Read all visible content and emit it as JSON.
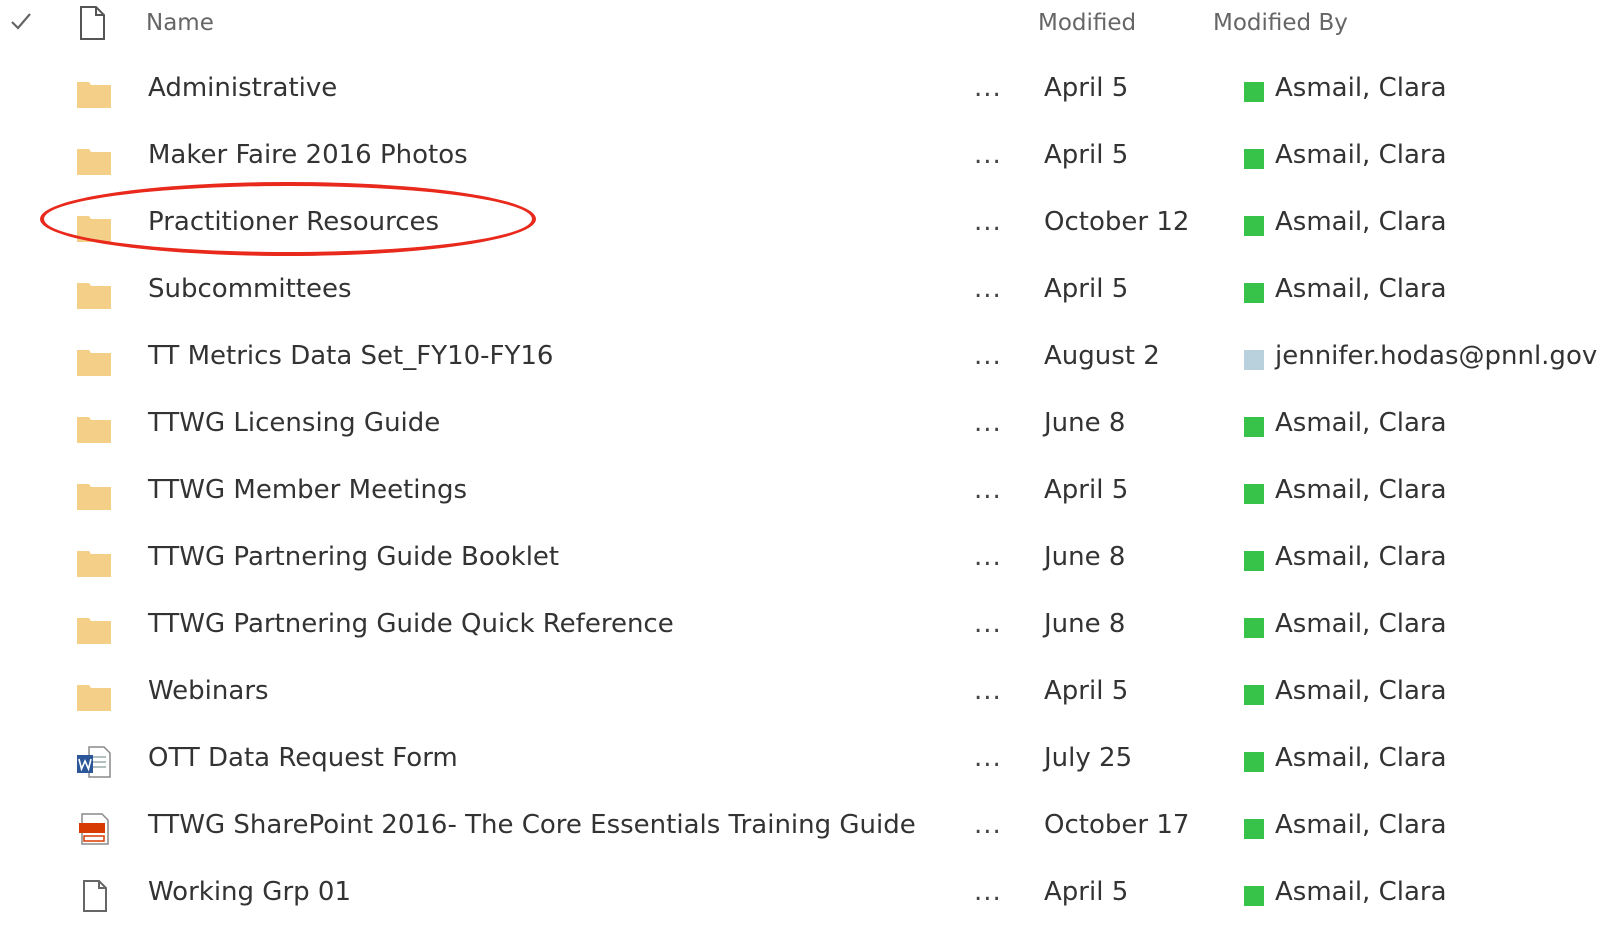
{
  "header": {
    "name_label": "Name",
    "modified_label": "Modified",
    "modified_by_label": "Modified By"
  },
  "colors": {
    "folder": "#f3cf87",
    "presence_available": "#37c24a",
    "presence_unknown": "#b9d1dd",
    "annotation": "#e8291c",
    "word_blue": "#2b579a",
    "pdf_red": "#d83b01"
  },
  "more_glyph": "...",
  "rows": [
    {
      "icon": "folder-icon",
      "name": "Administrative",
      "modified": "April 5",
      "modified_by": "Asmail, Clara",
      "presence": "presence_available"
    },
    {
      "icon": "folder-icon",
      "name": "Maker Faire 2016 Photos",
      "modified": "April 5",
      "modified_by": "Asmail, Clara",
      "presence": "presence_available"
    },
    {
      "icon": "folder-icon",
      "name": "Practitioner Resources",
      "modified": "October 12",
      "modified_by": "Asmail, Clara",
      "presence": "presence_available"
    },
    {
      "icon": "folder-icon",
      "name": "Subcommittees",
      "modified": "April 5",
      "modified_by": "Asmail, Clara",
      "presence": "presence_available"
    },
    {
      "icon": "folder-icon",
      "name": "TT Metrics Data Set_FY10-FY16",
      "modified": "August 2",
      "modified_by": "jennifer.hodas@pnnl.gov",
      "presence": "presence_unknown"
    },
    {
      "icon": "folder-icon",
      "name": "TTWG Licensing Guide",
      "modified": "June 8",
      "modified_by": "Asmail, Clara",
      "presence": "presence_available"
    },
    {
      "icon": "folder-icon",
      "name": "TTWG Member Meetings",
      "modified": "April 5",
      "modified_by": "Asmail, Clara",
      "presence": "presence_available"
    },
    {
      "icon": "folder-icon",
      "name": "TTWG Partnering Guide Booklet",
      "modified": "June 8",
      "modified_by": "Asmail, Clara",
      "presence": "presence_available"
    },
    {
      "icon": "folder-icon",
      "name": "TTWG Partnering Guide Quick Reference",
      "modified": "June 8",
      "modified_by": "Asmail, Clara",
      "presence": "presence_available"
    },
    {
      "icon": "folder-icon",
      "name": "Webinars",
      "modified": "April 5",
      "modified_by": "Asmail, Clara",
      "presence": "presence_available"
    },
    {
      "icon": "word-doc-icon",
      "name": "OTT Data Request Form",
      "modified": "July 25",
      "modified_by": "Asmail, Clara",
      "presence": "presence_available"
    },
    {
      "icon": "pdf-doc-icon",
      "name": "TTWG SharePoint 2016- The Core Essentials Training Guide",
      "modified": "October 17",
      "modified_by": "Asmail, Clara",
      "presence": "presence_available"
    },
    {
      "icon": "generic-file-icon",
      "name": "Working Grp 01",
      "modified": "April 5",
      "modified_by": "Asmail, Clara",
      "presence": "presence_available"
    }
  ]
}
